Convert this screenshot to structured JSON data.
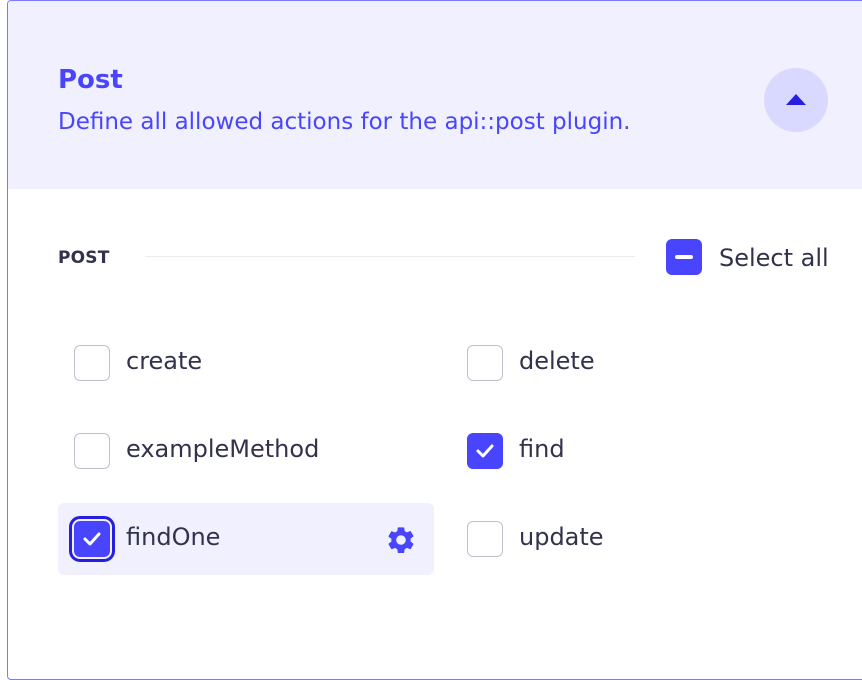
{
  "header": {
    "title": "Post",
    "subtitle": "Define all allowed actions for the api::post plugin.",
    "collapse_icon": "chevron-up-icon"
  },
  "section": {
    "label": "POST",
    "select_all": {
      "label": "Select all",
      "state": "indeterminate"
    }
  },
  "actions": [
    {
      "label": "create",
      "checked": false
    },
    {
      "label": "delete",
      "checked": false
    },
    {
      "label": "exampleMethod",
      "checked": false
    },
    {
      "label": "find",
      "checked": true
    },
    {
      "label": "findOne",
      "checked": true,
      "focused": true,
      "settings_icon": "gear-icon"
    },
    {
      "label": "update",
      "checked": false
    }
  ],
  "colors": {
    "primary": "#4945ff",
    "header_bg": "#f0f0ff",
    "text": "#32324d",
    "border": "#c0c0cf"
  }
}
